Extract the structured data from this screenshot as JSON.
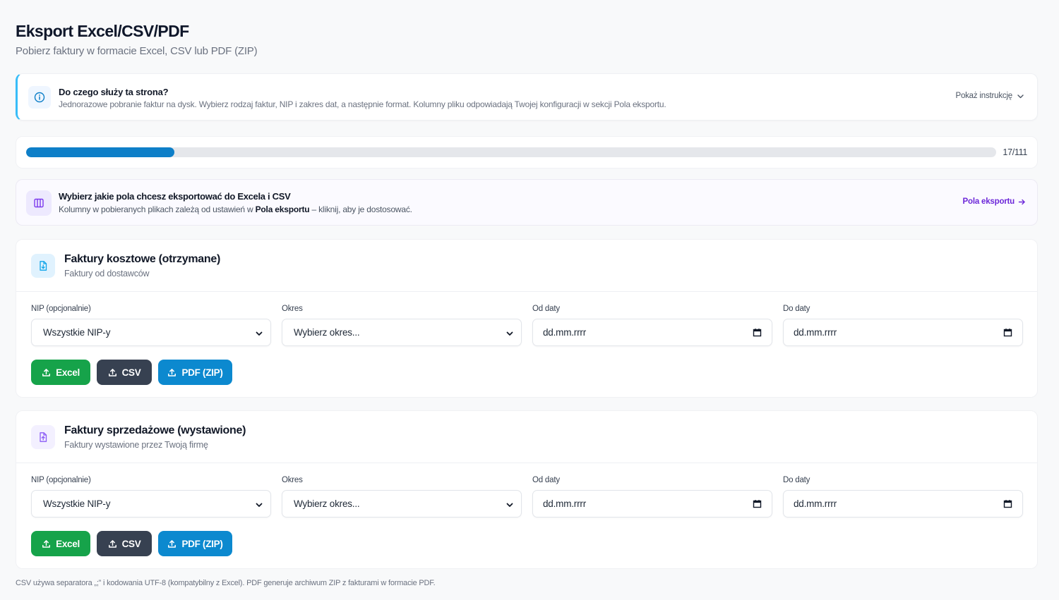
{
  "header": {
    "title": "Eksport Excel/CSV/PDF",
    "subtitle": "Pobierz faktury w formacie Excel, CSV lub PDF (ZIP)"
  },
  "info": {
    "title": "Do czego służy ta strona?",
    "text": "Jednorazowe pobranie faktur na dysk. Wybierz rodzaj faktur, NIP i zakres dat, a następnie format. Kolumny pliku odpowiadają Twojej konfiguracji w sekcji Pola eksportu.",
    "toggle_label": "Pokaż instrukcję",
    "icon": "info-icon",
    "accent": "#38bdf8"
  },
  "progress": {
    "label": "17/111",
    "fraction": 0.153,
    "color": "#0e7fc8"
  },
  "fields_notice": {
    "title": "Wybierz jakie pola chcesz eksportować do Excela i CSV",
    "text_before": "Kolumny w pobieranych plikach zależą od ustawień w ",
    "text_bold": "Pola eksportu",
    "text_after": " – kliknij, aby je dostosować.",
    "link_label": "Pola eksportu",
    "icon": "columns-icon",
    "accent": "#6d28d9"
  },
  "sections": [
    {
      "title": "Faktury kosztowe (otrzymane)",
      "subtitle": "Faktury od dostawców",
      "icon": "file-download-icon",
      "icon_color": "#0ea5e9",
      "icon_bg": "#e0f2fe",
      "nip_label": "NIP (opcjonalnie)",
      "nip_value": "Wszystkie NIP-y",
      "period_label": "Okres",
      "period_value": "Wybierz okres...",
      "from_label": "Od daty",
      "from_value": "dd.mm.rrrr",
      "to_label": "Do daty",
      "to_value": "dd.mm.rrrr",
      "btn_excel": "Excel",
      "btn_csv": "CSV",
      "btn_pdf": "PDF (ZIP)"
    },
    {
      "title": "Faktury sprzedażowe (wystawione)",
      "subtitle": "Faktury wystawione przez Twoją firmę",
      "icon": "file-upload-icon",
      "icon_color": "#8b5cf6",
      "icon_bg": "#f3f0ff",
      "nip_label": "NIP (opcjonalnie)",
      "nip_value": "Wszystkie NIP-y",
      "period_label": "Okres",
      "period_value": "Wybierz okres...",
      "from_label": "Od daty",
      "from_value": "dd.mm.rrrr",
      "to_label": "Do daty",
      "to_value": "dd.mm.rrrr",
      "btn_excel": "Excel",
      "btn_csv": "CSV",
      "btn_pdf": "PDF (ZIP)"
    }
  ],
  "footnote": "CSV używa separatora „;” i kodowania UTF-8 (kompatybilny z Excel). PDF generuje archiwum ZIP z fakturami w formacie PDF."
}
